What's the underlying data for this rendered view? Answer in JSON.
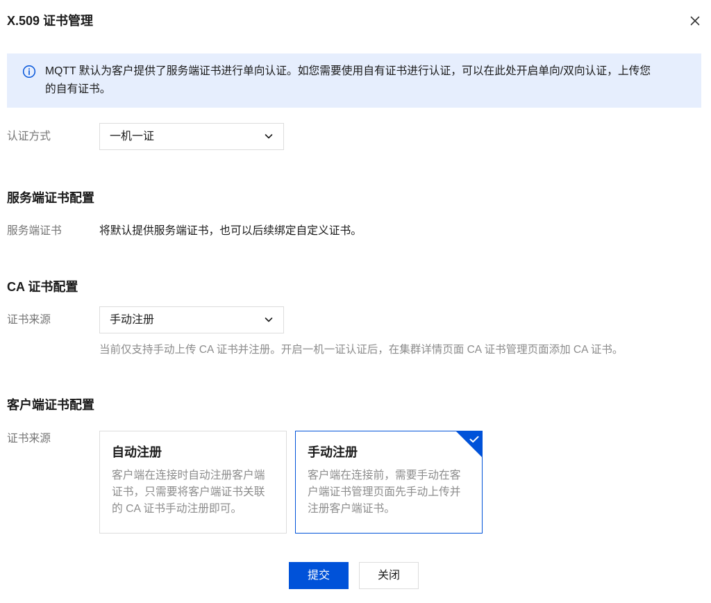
{
  "dialog": {
    "title": "X.509 证书管理",
    "close_icon": "close-icon"
  },
  "notice": {
    "icon": "info-icon",
    "text": "MQTT 默认为客户提供了服务端证书进行单向认证。如您需要使用自有证书进行认证，可以在此处开启单向/双向认证，上传您的自有证书。"
  },
  "auth": {
    "label": "认证方式",
    "value": "一机一证",
    "icon": "chevron-down-icon"
  },
  "server_section": {
    "heading": "服务端证书配置",
    "label": "服务端证书",
    "text": "将默认提供服务端证书，也可以后续绑定自定义证书。"
  },
  "ca_section": {
    "heading": "CA 证书配置",
    "label": "证书来源",
    "value": "手动注册",
    "icon": "chevron-down-icon",
    "help": "当前仅支持手动上传 CA 证书并注册。开启一机一证认证后，在集群详情页面 CA 证书管理页面添加 CA 证书。"
  },
  "client_section": {
    "heading": "客户端证书配置",
    "label": "证书来源",
    "options": [
      {
        "title": "自动注册",
        "description": "客户端在连接时自动注册客户端证书，只需要将客户端证书关联的 CA 证书手动注册即可。",
        "selected": false
      },
      {
        "title": "手动注册",
        "description": "客户端在连接前，需要手动在客户端证书管理页面先手动上传并注册客户端证书。",
        "selected": true,
        "selected_icon": "check-icon"
      }
    ]
  },
  "footer": {
    "submit_label": "提交",
    "close_label": "关闭"
  },
  "colors": {
    "primary": "#0052d9",
    "notice_bg": "#e6eefd"
  }
}
